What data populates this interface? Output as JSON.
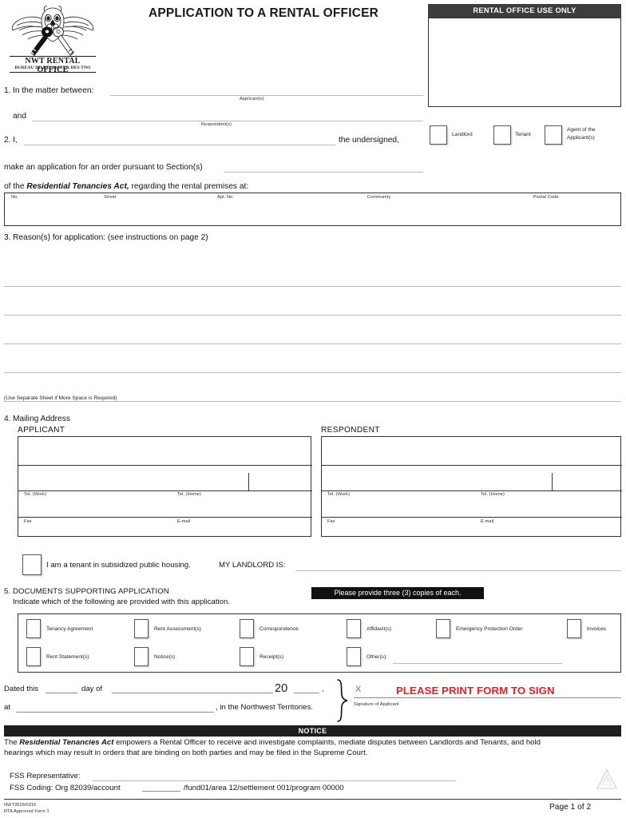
{
  "header": {
    "title": "APPLICATION TO A RENTAL OFFICER",
    "logo": {
      "line1": "NWT RENTAL OFFICE",
      "line2": "BUREAU DU RÉGISSEUR DES TNO",
      "alt": "owl-with-keys-logo"
    }
  },
  "office_use": {
    "banner": "RENTAL OFFICE USE ONLY",
    "roles": [
      {
        "label": "Landlord"
      },
      {
        "label": "Tenant"
      },
      {
        "label": "Agent of the\nApplicant(s)",
        "line1": "Agent of the",
        "line2": "Applicant(s)"
      }
    ]
  },
  "section1": {
    "number": "1.",
    "prompt": "In the matter between:",
    "applicant_caption": "Applicant(s)",
    "and": "and",
    "respondent_caption": "Respondent(s)"
  },
  "section2": {
    "number": "2.",
    "i_label": "I,",
    "undersigned": "the undersigned,",
    "make_application": "make an application for an order pursuant to Section(s)",
    "act_prefix": "of the",
    "act_name": "Residential Tenancies Act,",
    "act_suffix": "regarding the rental premises at:",
    "address_headers": [
      "No.",
      "Street",
      "Apt. No.",
      "Community",
      "Postal Code"
    ]
  },
  "section3": {
    "number": "3.",
    "heading": "Reason(s) for application: (see instructions on page 2)",
    "rule_count": 5,
    "footnote": "(Use Separate Sheet if More Space is Required)"
  },
  "section4": {
    "number": "4.",
    "heading": "Mailing Address",
    "applicant_heading": "APPLICANT",
    "respondent_heading": "RESPONDENT",
    "field_labels": [
      "Tel. (Work)",
      "Tel. (Home)",
      "Fax",
      "E-mail"
    ],
    "subsidized": {
      "checkbox_label": "I am a tenant in subsidized public housing.",
      "landlord_prompt": "MY LANDLORD IS:"
    }
  },
  "section5": {
    "number": "5.",
    "heading": "DOCUMENTS SUPPORTING APPLICATION",
    "subheading": "Indicate which of the following are provided with this application.",
    "copies_banner": "Please provide three (3) copies of each.",
    "row1": [
      {
        "label": "Tenancy Agreement"
      },
      {
        "label": "Rent Assessment(s)"
      },
      {
        "label": "Correspondence"
      },
      {
        "label": "Affidavit(s)"
      },
      {
        "label": "Emergency Protection Order"
      },
      {
        "label": "Invoices"
      }
    ],
    "row2": [
      {
        "label": "Rent Statement(s)"
      },
      {
        "label": "Notice(s)"
      },
      {
        "label": "Receipt(s)"
      },
      {
        "label": "Other(s):"
      }
    ]
  },
  "signing": {
    "dated_this": "Dated this",
    "day_of": "day of",
    "year_prefix": "20",
    "comma": ",",
    "at": "at",
    "territories": ", in the Northwest Territories.",
    "x_mark": "X",
    "print_to_sign": "PLEASE PRINT FORM TO SIGN",
    "signature_caption": "Signature of Applicant"
  },
  "notice": {
    "banner": "NOTICE",
    "text_a": "The",
    "act_name": "Residential Tenancies Act",
    "text_b": "empowers a Rental Officer to receive and investigate complaints, mediate disputes between Landlords and Tenants, and hold",
    "text_c": "hearings which may result in orders that are binding on both parties and may be filed in the Supreme Court."
  },
  "fss": {
    "representative_label": "FSS Representative:",
    "coding": "FSS Coding: Org 82039/account",
    "coding_tail": "/fund01/area 12/settlement 001/program 00000"
  },
  "footer": {
    "form_number": "NWT3529/0316",
    "form_name": "RTA Approved Form 1",
    "page": "Page 1 of 2",
    "seal_alt": "gnwt-recycle-seal"
  },
  "colors": {
    "office_banner_bg": "#3d3d3d",
    "notice_bg": "#1d1d1d",
    "accent_red": "#ee1c25",
    "rule": "#b9b9b9"
  }
}
